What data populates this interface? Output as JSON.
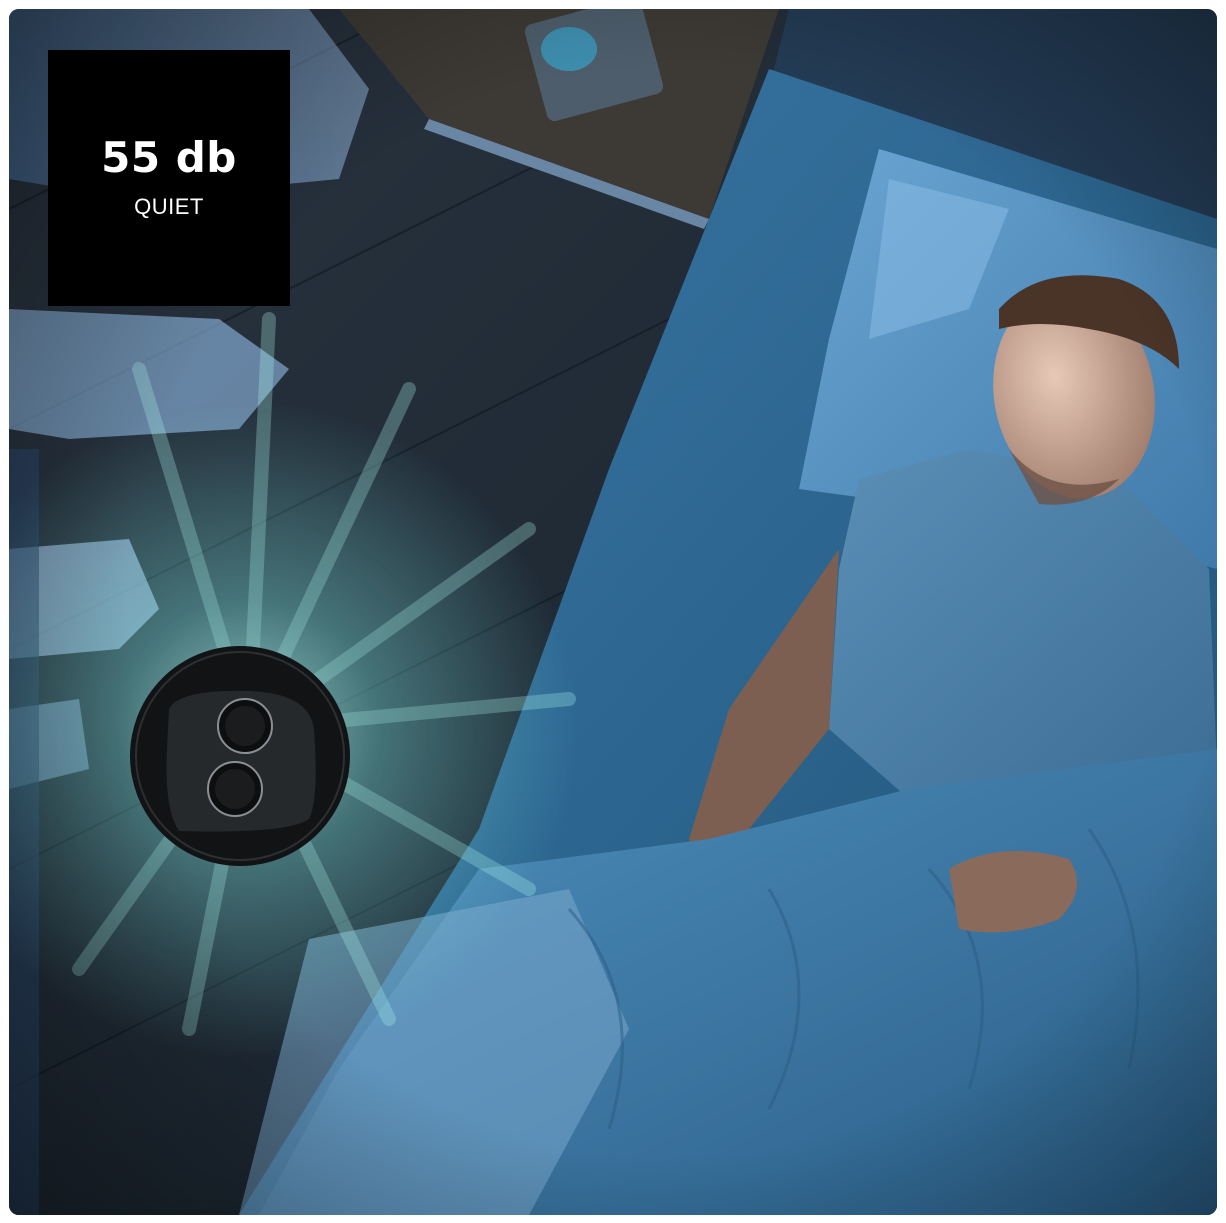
{
  "badge": {
    "value": "55 db",
    "label": "QUIET"
  },
  "colors": {
    "badge_background": "#000000",
    "badge_text": "#ffffff",
    "scene_tone": "#1f4f73",
    "airflow_glow": "#7fe6df"
  },
  "icons": {
    "device": "fan-top-view",
    "airflow": "air-stream-rays"
  }
}
